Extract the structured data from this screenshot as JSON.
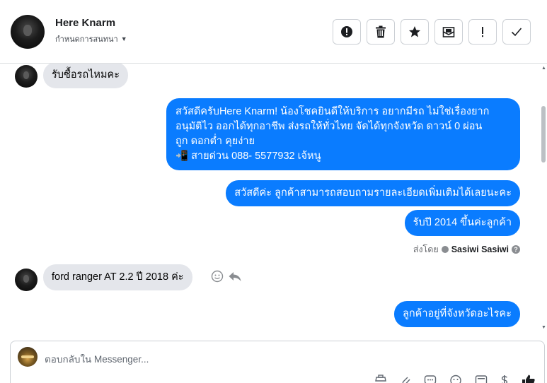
{
  "header": {
    "contact_name": "Here Knarm",
    "assign_label": "กำหนดการสนทนา",
    "actions": [
      {
        "name": "mark-spam-button",
        "icon": "alert-circle-icon"
      },
      {
        "name": "delete-button",
        "icon": "trash-icon"
      },
      {
        "name": "star-button",
        "icon": "star-icon"
      },
      {
        "name": "mark-unread-button",
        "icon": "envelope-icon"
      },
      {
        "name": "follow-up-button",
        "icon": "exclamation-icon"
      },
      {
        "name": "mark-done-button",
        "icon": "check-icon"
      }
    ]
  },
  "messages": {
    "m1": "รับซื้อรถไหมคะ",
    "m2_lines": [
      "สวัสดีครับHere Knarm! น้องโชคยินดีให้บริการ อยากมีรถ ไม่ใช่เรื่องยาก",
      "อนุมัติไว ออกได้ทุกอาชีพ ส่งรถให้ทั่วไทย จัดได้ทุกจังหวัด ดาวน์ 0  ผ่อน",
      "ถูก ดอกต่ำ คุยง่าย",
      "📲 สายด่วน 088- 5577932 เจ้หนู"
    ],
    "m3": "สวัสดีค่ะ ลูกค้าสามารถสอบถามรายละเอียดเพิ่มเติมได้เลยนะคะ",
    "m4": "รับปี 2014 ขึ้นค่ะลูกค้า",
    "sent_by_label": "ส่งโดย",
    "sent_by_name": "Sasiwi Sasiwi",
    "m5": "ford ranger AT 2.2 ปี 2018 ค่ะ",
    "m6": "ลูกค้าอยู่ที่จังหวัดอะไรคะ"
  },
  "composer": {
    "placeholder": "ตอบกลับใน Messenger..."
  },
  "colors": {
    "outgoing": "#0a7cff",
    "incoming": "#e4e6eb"
  }
}
